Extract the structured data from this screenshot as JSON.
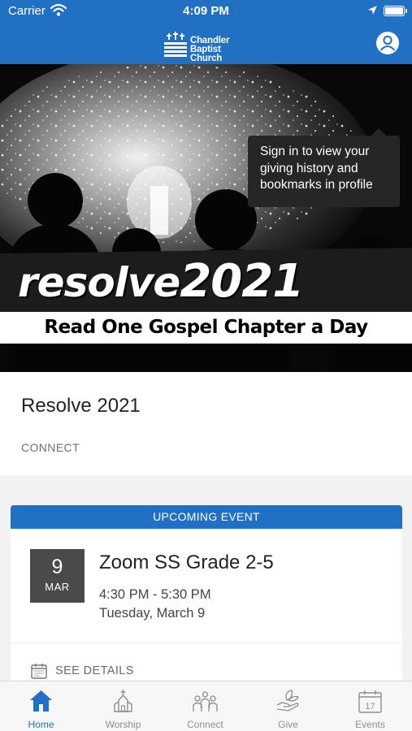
{
  "status_bar": {
    "carrier": "Carrier",
    "time": "4:09 PM"
  },
  "header": {
    "logo_line1": "Chandler",
    "logo_line2": "Baptist Church",
    "brand_color": "#2270c4",
    "profile_icon": "person-circle-icon"
  },
  "tooltip": {
    "text": "Sign in to view your giving history and bookmarks in profile"
  },
  "hero": {
    "headline_left": "resolve",
    "headline_right": "2021",
    "subtitle": "Read One Gospel Chapter a Day"
  },
  "feature": {
    "title": "Resolve 2021",
    "tag": "CONNECT"
  },
  "event": {
    "header": "UPCOMING EVENT",
    "day": "9",
    "month": "MAR",
    "title": "Zoom SS Grade 2-5",
    "time": "4:30 PM - 5:30 PM",
    "date": "Tuesday, March 9",
    "details_label": "SEE DETAILS"
  },
  "tab_bar": {
    "active_color": "#2270c4",
    "tabs": [
      {
        "label": "Home",
        "icon": "home-icon",
        "active": true
      },
      {
        "label": "Worship",
        "icon": "church-icon",
        "active": false
      },
      {
        "label": "Connect",
        "icon": "people-icon",
        "active": false
      },
      {
        "label": "Give",
        "icon": "hand-leaf-icon",
        "active": false
      },
      {
        "label": "Events",
        "icon": "calendar-icon",
        "active": false,
        "icon_text": "17"
      }
    ]
  }
}
